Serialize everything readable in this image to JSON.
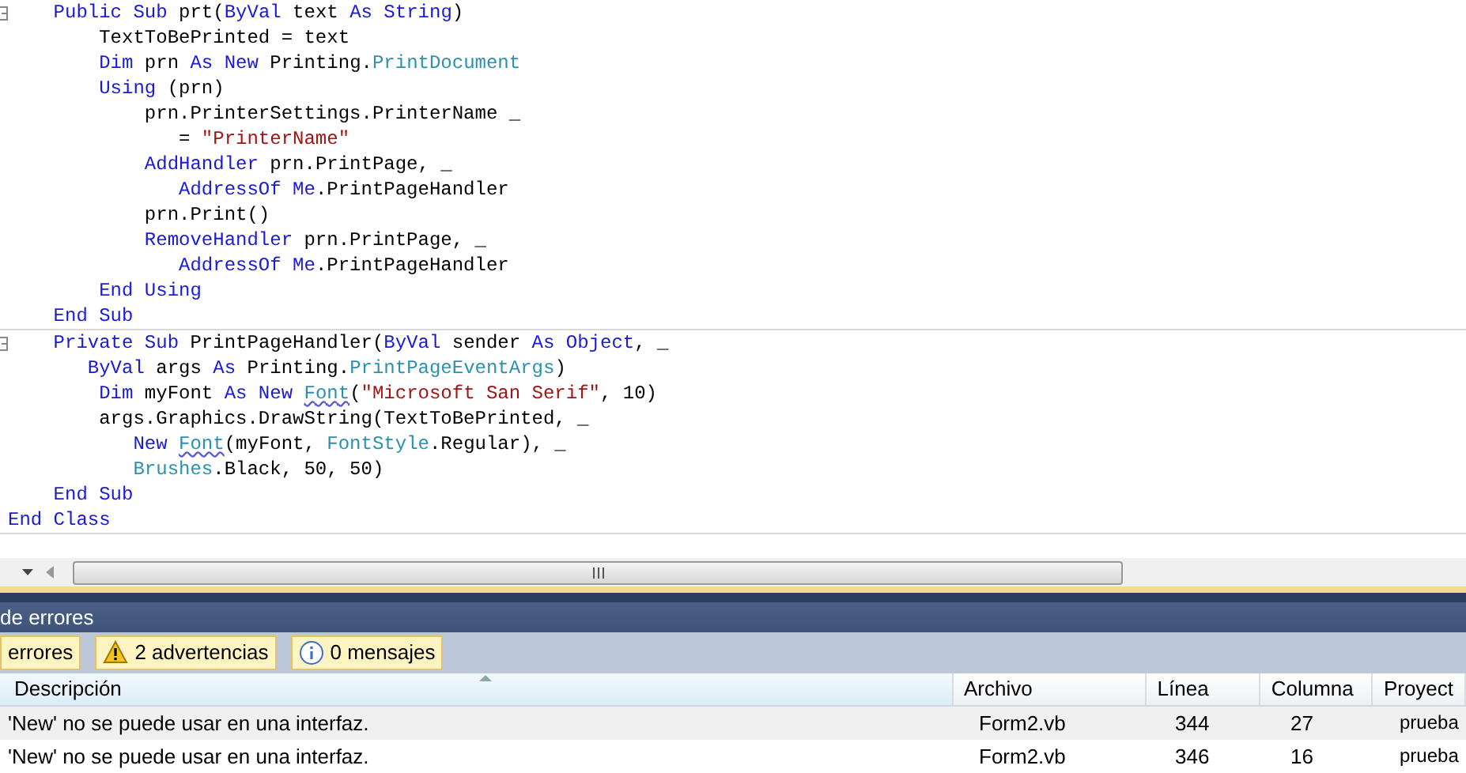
{
  "editor": {
    "blocks": [
      {
        "lines": [
          [
            {
              "kind": "kw",
              "text": "    Public Sub"
            },
            {
              "kind": "plain",
              "text": " prt("
            },
            {
              "kind": "kw",
              "text": "ByVal"
            },
            {
              "kind": "plain",
              "text": " text "
            },
            {
              "kind": "kw",
              "text": "As String"
            },
            {
              "kind": "plain",
              "text": ")"
            }
          ],
          [
            {
              "kind": "plain",
              "text": "        TextToBePrinted = text"
            }
          ],
          [
            {
              "kind": "kw",
              "text": "        Dim"
            },
            {
              "kind": "plain",
              "text": " prn "
            },
            {
              "kind": "kw",
              "text": "As New"
            },
            {
              "kind": "plain",
              "text": " Printing."
            },
            {
              "kind": "type",
              "text": "PrintDocument"
            }
          ],
          [
            {
              "kind": "kw",
              "text": "        Using"
            },
            {
              "kind": "plain",
              "text": " (prn)"
            }
          ],
          [
            {
              "kind": "plain",
              "text": "            prn.PrinterSettings.PrinterName _"
            }
          ],
          [
            {
              "kind": "plain",
              "text": "               = "
            },
            {
              "kind": "str",
              "text": "\"PrinterName\""
            }
          ],
          [
            {
              "kind": "kw",
              "text": "            AddHandler"
            },
            {
              "kind": "plain",
              "text": " prn.PrintPage, _"
            }
          ],
          [
            {
              "kind": "kw",
              "text": "               AddressOf Me"
            },
            {
              "kind": "plain",
              "text": ".PrintPageHandler"
            }
          ],
          [
            {
              "kind": "plain",
              "text": "            prn.Print()"
            }
          ],
          [
            {
              "kind": "kw",
              "text": "            RemoveHandler"
            },
            {
              "kind": "plain",
              "text": " prn.PrintPage, _"
            }
          ],
          [
            {
              "kind": "kw",
              "text": "               AddressOf Me"
            },
            {
              "kind": "plain",
              "text": ".PrintPageHandler"
            }
          ],
          [
            {
              "kind": "kw",
              "text": "        End Using"
            }
          ],
          [
            {
              "kind": "kw",
              "text": "    End Sub"
            }
          ]
        ]
      },
      {
        "lines": [
          [
            {
              "kind": "kw",
              "text": "    Private Sub"
            },
            {
              "kind": "plain",
              "text": " PrintPageHandler("
            },
            {
              "kind": "kw",
              "text": "ByVal"
            },
            {
              "kind": "plain",
              "text": " sender "
            },
            {
              "kind": "kw",
              "text": "As Object"
            },
            {
              "kind": "plain",
              "text": ", _"
            }
          ],
          [
            {
              "kind": "kw",
              "text": "       ByVal"
            },
            {
              "kind": "plain",
              "text": " args "
            },
            {
              "kind": "kw",
              "text": "As"
            },
            {
              "kind": "plain",
              "text": " Printing."
            },
            {
              "kind": "type",
              "text": "PrintPageEventArgs"
            },
            {
              "kind": "plain",
              "text": ")"
            }
          ],
          [
            {
              "kind": "kw",
              "text": "        Dim"
            },
            {
              "kind": "plain",
              "text": " myFont "
            },
            {
              "kind": "kw",
              "text": "As New "
            },
            {
              "kind": "err",
              "text": "Font"
            },
            {
              "kind": "plain",
              "text": "("
            },
            {
              "kind": "str",
              "text": "\"Microsoft San Serif\""
            },
            {
              "kind": "plain",
              "text": ", 10)"
            }
          ],
          [
            {
              "kind": "plain",
              "text": "        args.Graphics.DrawString(TextToBePrinted, _"
            }
          ],
          [
            {
              "kind": "kw",
              "text": "           New "
            },
            {
              "kind": "err",
              "text": "Font"
            },
            {
              "kind": "plain",
              "text": "(myFont, "
            },
            {
              "kind": "type",
              "text": "FontStyle"
            },
            {
              "kind": "plain",
              "text": ".Regular), _"
            }
          ],
          [
            {
              "kind": "type",
              "text": "           Brushes"
            },
            {
              "kind": "plain",
              "text": ".Black, 50, 50)"
            }
          ],
          [
            {
              "kind": "kw",
              "text": "    End Sub"
            }
          ],
          [
            {
              "kind": "kw",
              "text": "End Class"
            }
          ]
        ]
      }
    ]
  },
  "error_list": {
    "title": "de errores",
    "filters": [
      {
        "kind": "error",
        "label": "errores",
        "selected": true
      },
      {
        "kind": "warning",
        "label": "2 advertencias",
        "selected": true
      },
      {
        "kind": "info",
        "label": "0 mensajes",
        "selected": true
      }
    ],
    "columns": [
      "Descripción",
      "Archivo",
      "Línea",
      "Columna",
      "Proyect"
    ],
    "rows": [
      [
        "'New' no se puede usar en una interfaz.",
        "Form2.vb",
        "344",
        "27",
        "prueba"
      ],
      [
        "'New' no se puede usar en una interfaz.",
        "Form2.vb",
        "346",
        "16",
        "prueba"
      ]
    ]
  }
}
